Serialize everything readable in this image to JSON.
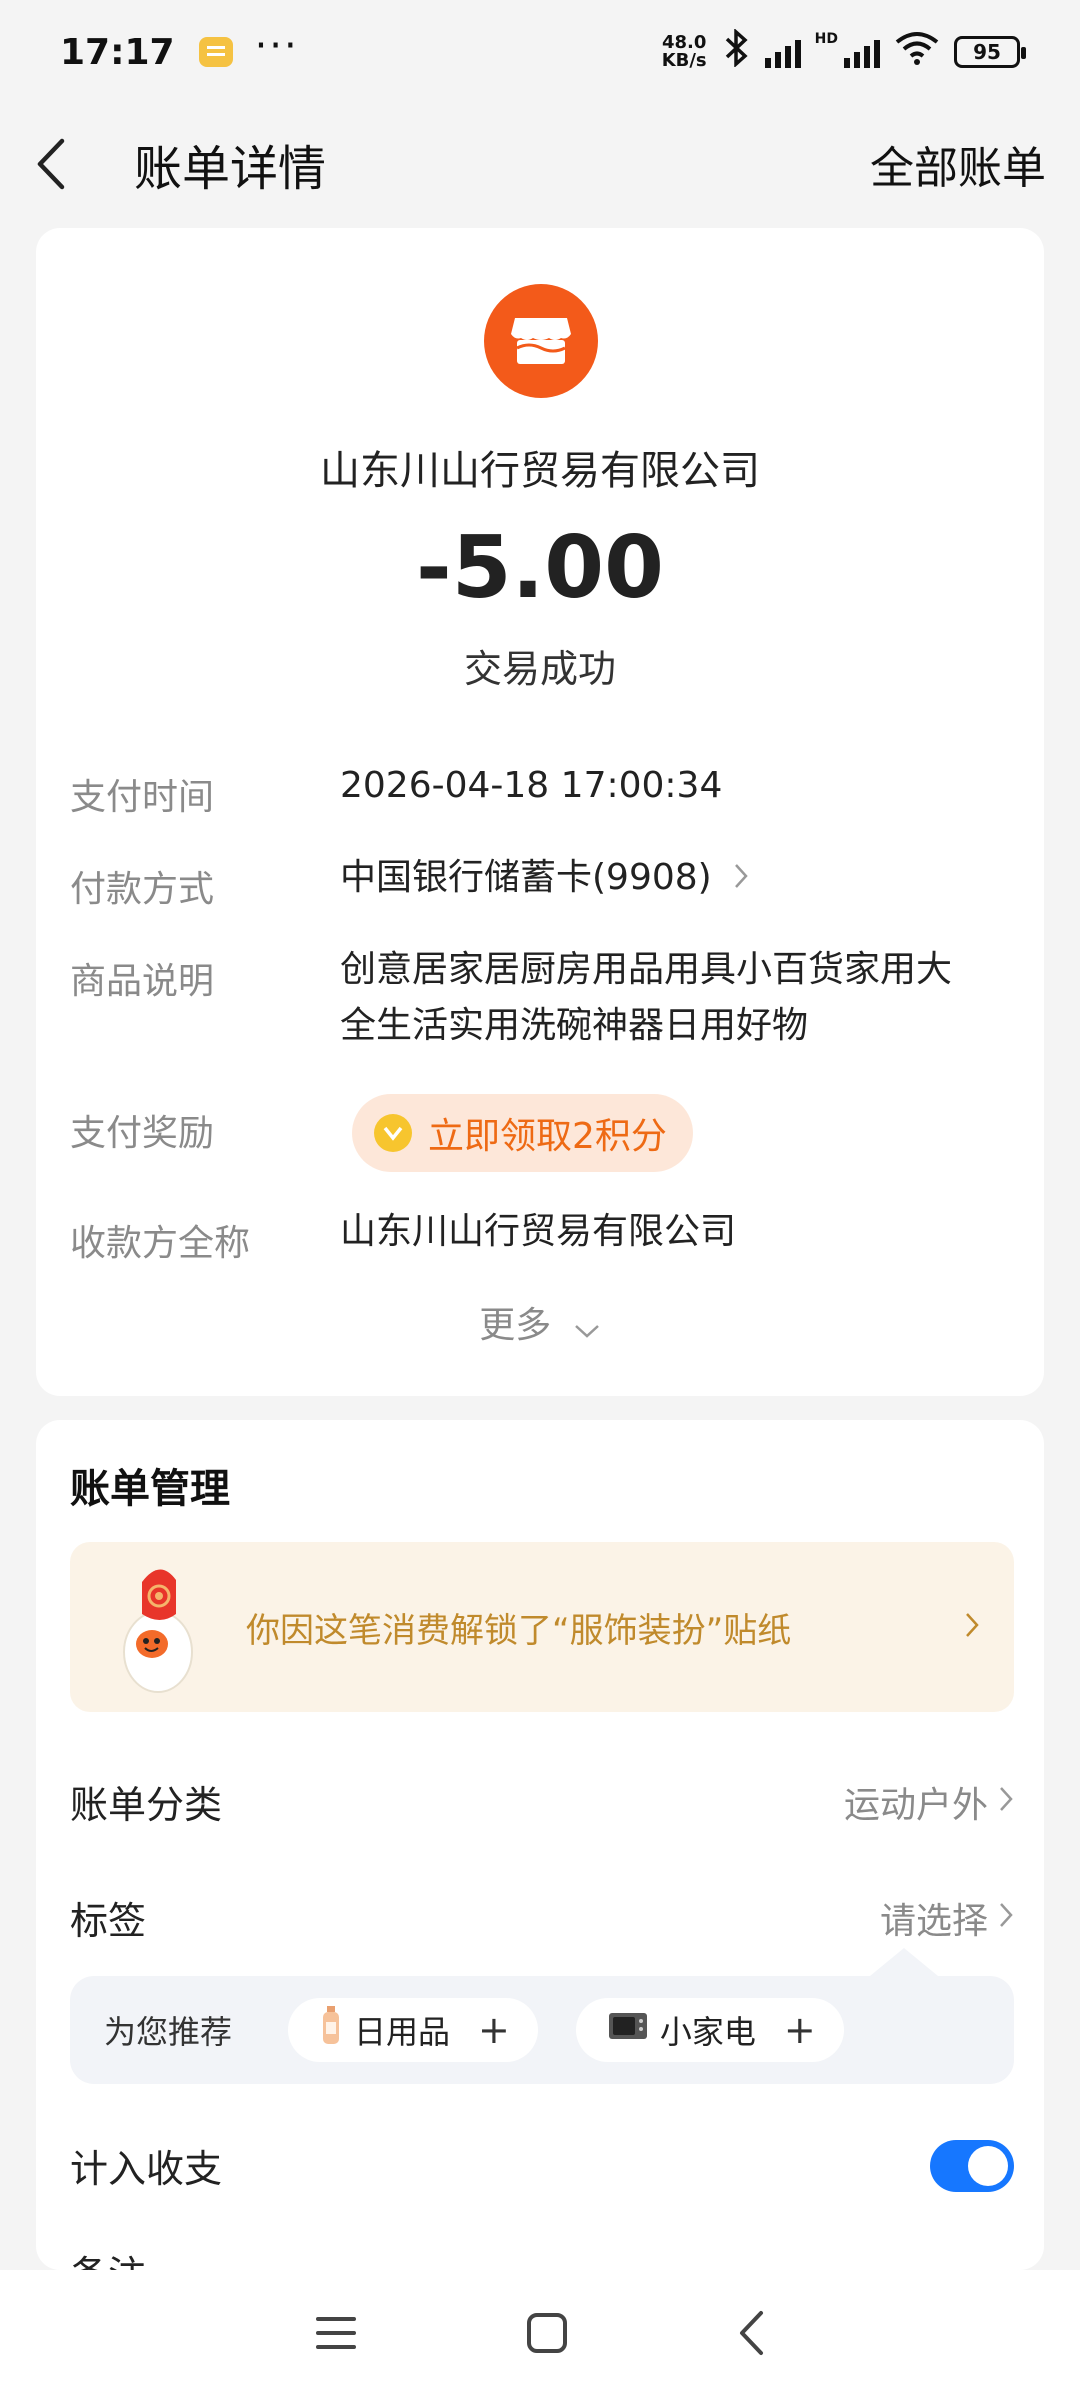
{
  "status_bar": {
    "time": "17:17",
    "more_dots": "···",
    "net_speed_value": "48.0",
    "net_speed_unit": "KB/s",
    "signal_label": "HD",
    "battery": "95"
  },
  "nav": {
    "title": "账单详情",
    "right_action": "全部账单"
  },
  "bill": {
    "merchant_name": "山东川山行贸易有限公司",
    "amount": "-5.00",
    "status": "交易成功",
    "details": [
      {
        "label": "支付时间",
        "value": "2026-04-18 17:00:34"
      },
      {
        "label": "付款方式",
        "value": "中国银行储蓄卡(9908)"
      },
      {
        "label": "商品说明",
        "value_line1": "创意居家居厨房用品用具小百货家用大",
        "value_line2": "全生活实用洗碗神器日用好物"
      },
      {
        "label": "支付奖励",
        "value": "立即领取2积分"
      },
      {
        "label": "收款方全称",
        "value": "山东川山行贸易有限公司"
      }
    ],
    "more_label": "更多"
  },
  "manage": {
    "title": "账单管理",
    "sticker_text": "你因这笔消费解锁了“服饰装扮”贴纸",
    "category_label": "账单分类",
    "category_value": "运动户外",
    "tag_label": "标签",
    "tag_value": "请选择",
    "recommend_label": "为您推荐",
    "recommend_chips": [
      "日用品",
      "小家电"
    ],
    "count_label": "计入收支",
    "count_enabled": true,
    "remark_label": "备注"
  },
  "colors": {
    "accent": "#1677ff",
    "merchant_icon": "#f35a1a",
    "reward_text": "#ee6a14",
    "sticker_text": "#c08a2c"
  },
  "icons": {
    "back": "chevron-left-icon",
    "merchant": "store-icon",
    "coin": "coin-icon",
    "bluetooth": "bluetooth-icon",
    "wifi": "wifi-icon",
    "nav_menu": "menu-icon",
    "nav_home": "home-square-icon",
    "nav_back": "back-triangle-icon"
  }
}
